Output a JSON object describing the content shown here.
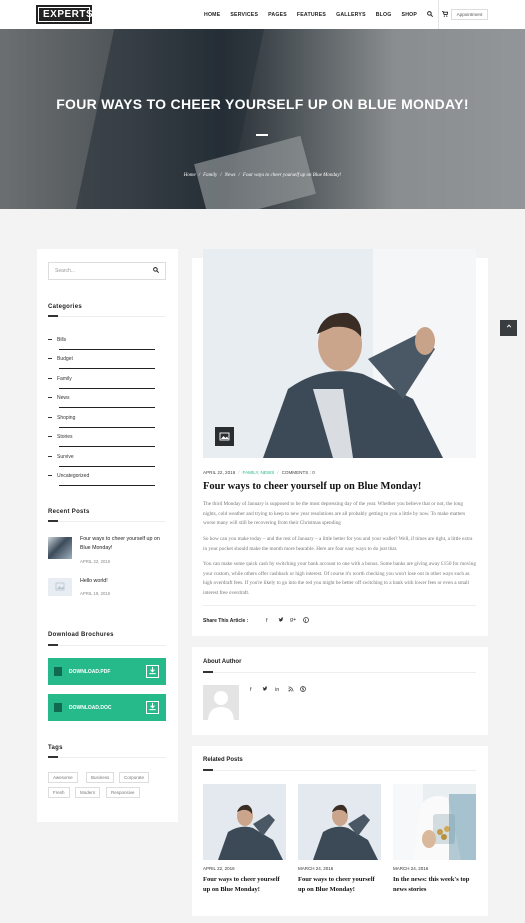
{
  "header": {
    "logo": "EXPERTS",
    "nav": [
      "HOME",
      "SERVICES",
      "PAGES",
      "FEATURES",
      "GALLERYS",
      "BLOG",
      "SHOP"
    ],
    "search_icon": "search-icon",
    "cart_icon": "cart-icon",
    "appointment": "Appointment"
  },
  "hero": {
    "title": "FOUR WAYS TO CHEER YOURSELF UP ON BLUE MONDAY!",
    "breadcrumb": [
      "Home",
      "Family",
      "News",
      "Four ways to cheer yourself up on Blue Monday!"
    ],
    "breadcrumb_sep": "/"
  },
  "sidebar": {
    "search_placeholder": "Search...",
    "categories_title": "Categories",
    "categories": [
      "Bills",
      "Budget",
      "Family",
      "News",
      "Shoping",
      "Stories",
      "Survive",
      "Uncategorized"
    ],
    "recent_title": "Recent Posts",
    "recent": [
      {
        "title": "Four ways to cheer yourself up on Blue Monday!",
        "date": "APRIL 22, 2016"
      },
      {
        "title": "Hello world!",
        "date": "APRIL 19, 2016"
      }
    ],
    "brochures_title": "Download Brochures",
    "downloads": [
      "DOWNLOAD.PDF",
      "DOWNLOAD.DOC"
    ],
    "tags_title": "Tags",
    "tags": [
      "Awesome",
      "Business",
      "Corporate",
      "Fresh",
      "Modern",
      "Responsive"
    ]
  },
  "post": {
    "date": "APRIL 22, 2016",
    "categories": "FAMILY, NEWS",
    "comments": "COMMENTS : 0",
    "title": "Four ways to cheer yourself up on Blue Monday!",
    "paragraphs": [
      "The third Monday of January is supposed to be the most depressing day of the year. Whether you believe that or not, the long nights, cold weather and trying to keep to new year resolutions are all probably getting to you a little by now. To make matters worse many will still be recovering from their Christmas spending",
      "So how can you make today – and the rest of January – a little better for you and your wallet? Well, if times are tight, a little extra in your pocket should make the month more bearable. Here are four easy ways to do just that.",
      "You can make some quick cash by switching your bank account to one with a bonus. Some banks are giving away £150 for moving your custom, while others offer cashback or high interest. Of course it's worth checking you won't lose out in other ways such as high overdraft fees. If you're likely to go into the red you might be better off switching to a bank with lower fees or even a small interest free overdraft."
    ],
    "share_label": "Share This Article :"
  },
  "author": {
    "title": "About Author"
  },
  "related": {
    "title": "Related Posts",
    "items": [
      {
        "date": "APRIL 22, 2016",
        "title": "Four ways to cheer yourself up on Blue Monday!"
      },
      {
        "date": "MARCH 24, 2016",
        "title": "Four ways to cheer yourself up on Blue Monday!"
      },
      {
        "date": "MARCH 24, 2016",
        "title": "In the news: this week's top news stories"
      }
    ]
  },
  "colors": {
    "accent": "#26b98a",
    "dark": "#222222"
  }
}
